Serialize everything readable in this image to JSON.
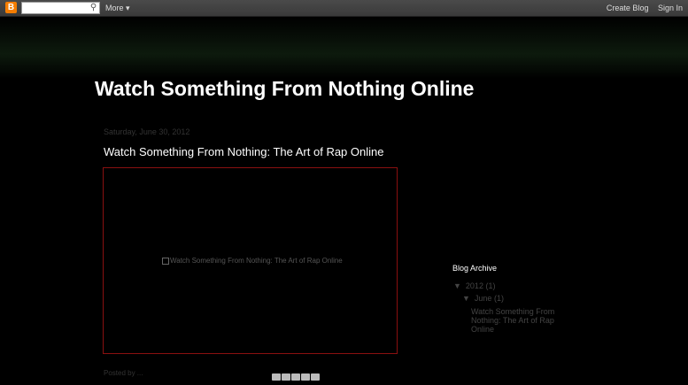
{
  "navbar": {
    "logo": "B",
    "search_placeholder": "",
    "more_label": "More",
    "create_blog_label": "Create Blog",
    "sign_in_label": "Sign In"
  },
  "header": {
    "title": "Watch Something From Nothing Online"
  },
  "post": {
    "date": "Saturday, June 30, 2012",
    "title": "Watch Something From Nothing: The Art of Rap Online",
    "image_alt": "Watch Something From Nothing: The Art of Rap Online",
    "footer": "Posted by ..."
  },
  "sidebar": {
    "archive_heading": "Blog Archive",
    "year_toggle": "▼",
    "year_label": "2012",
    "year_count": "(1)",
    "month_toggle": "▼",
    "month_label": "June",
    "month_count": "(1)",
    "post_link": "Watch Something From Nothing: The Art of Rap Online"
  },
  "colors": {
    "background": "#000000",
    "navbar": "#444444",
    "accent_border": "#8a1010",
    "title_text": "#ffffff"
  }
}
